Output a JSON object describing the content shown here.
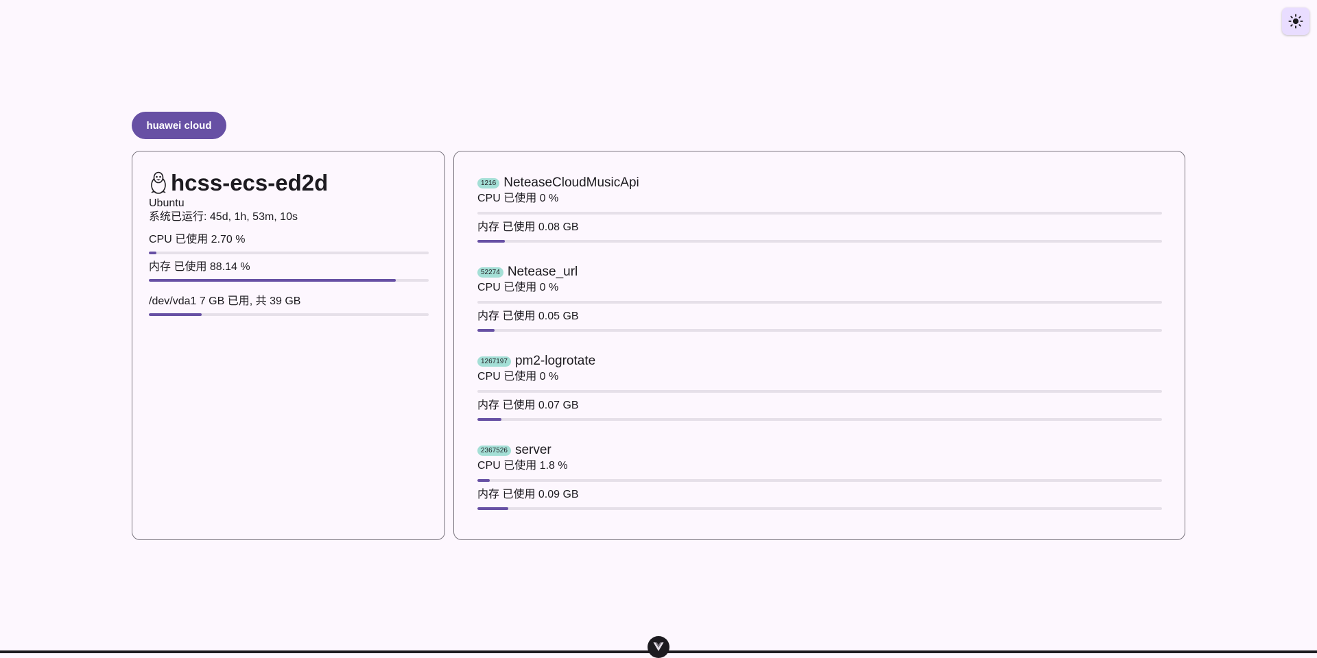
{
  "theme_toggle": {
    "icon": "sun-icon"
  },
  "group": {
    "label": "huawei cloud"
  },
  "host": {
    "icon": "linux-penguin-icon",
    "name": "hcss-ecs-ed2d",
    "os": "Ubuntu",
    "uptime": "系统已运行: 45d, 1h, 53m, 10s",
    "cpu": {
      "text": "CPU 已使用 2.70 %",
      "percent": 2.7
    },
    "memory": {
      "text": "内存 已使用 88.14 %",
      "percent": 88.14
    },
    "disk": {
      "text": "/dev/vda1 7 GB 已用, 共 39 GB",
      "percent": 18.95
    }
  },
  "processes": [
    {
      "pid": "1216",
      "name": "NeteaseCloudMusicApi",
      "cpu_text": "CPU 已使用 0 %",
      "cpu_percent": 0,
      "mem_text": "内存 已使用 0.08 GB",
      "mem_percent": 4
    },
    {
      "pid": "52274",
      "name": "Netease_url",
      "cpu_text": "CPU 已使用 0 %",
      "cpu_percent": 0,
      "mem_text": "内存 已使用 0.05 GB",
      "mem_percent": 2.5
    },
    {
      "pid": "1267197",
      "name": "pm2-logrotate",
      "cpu_text": "CPU 已使用 0 %",
      "cpu_percent": 0,
      "mem_text": "内存 已使用 0.07 GB",
      "mem_percent": 3.5
    },
    {
      "pid": "2367526",
      "name": "server",
      "cpu_text": "CPU 已使用 1.8 %",
      "cpu_percent": 1.8,
      "mem_text": "内存 已使用 0.09 GB",
      "mem_percent": 4.5
    }
  ],
  "footer": {
    "icon": "vue-logo-icon"
  },
  "colors": {
    "accent": "#6750a4",
    "badge": "#a4dfd6",
    "background": "#fdf7fe",
    "track": "#e6e0e9"
  }
}
